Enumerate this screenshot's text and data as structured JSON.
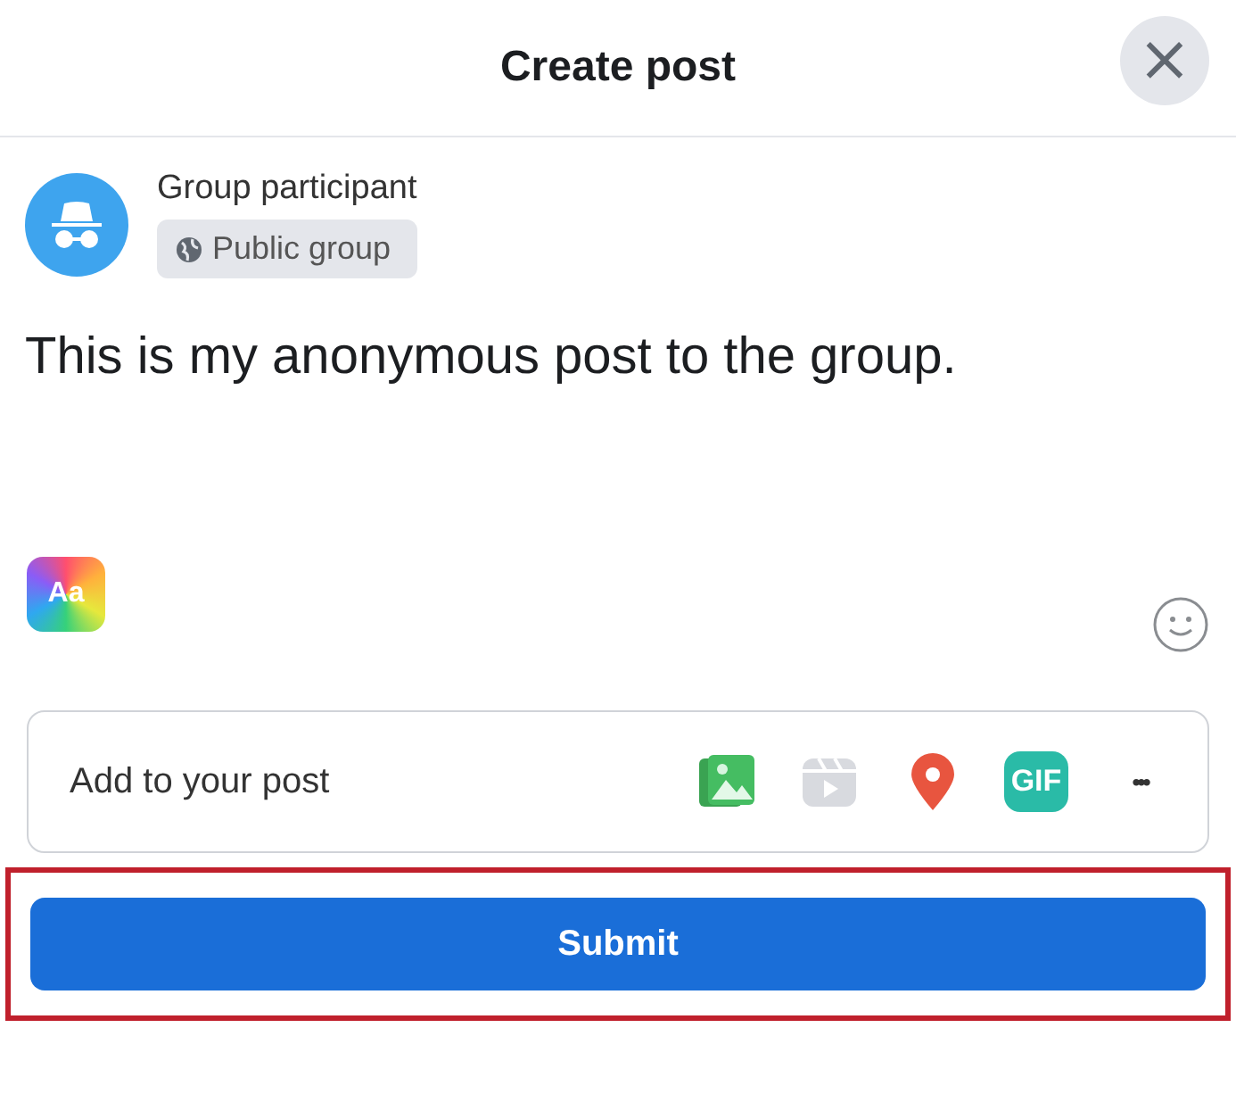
{
  "dialog": {
    "title": "Create post",
    "close_icon": "×"
  },
  "author": {
    "name": "Group participant",
    "audience": "Public group"
  },
  "post": {
    "text": "This is my anonymous post to the group."
  },
  "text_style": {
    "label": "Aa"
  },
  "add_to_post": {
    "label": "Add to your post",
    "items": [
      {
        "kind": "photo"
      },
      {
        "kind": "reel"
      },
      {
        "kind": "location"
      },
      {
        "kind": "gif",
        "label": "GIF"
      },
      {
        "kind": "more",
        "label": "•••"
      }
    ]
  },
  "submit": {
    "label": "Submit",
    "highlighted": true
  }
}
